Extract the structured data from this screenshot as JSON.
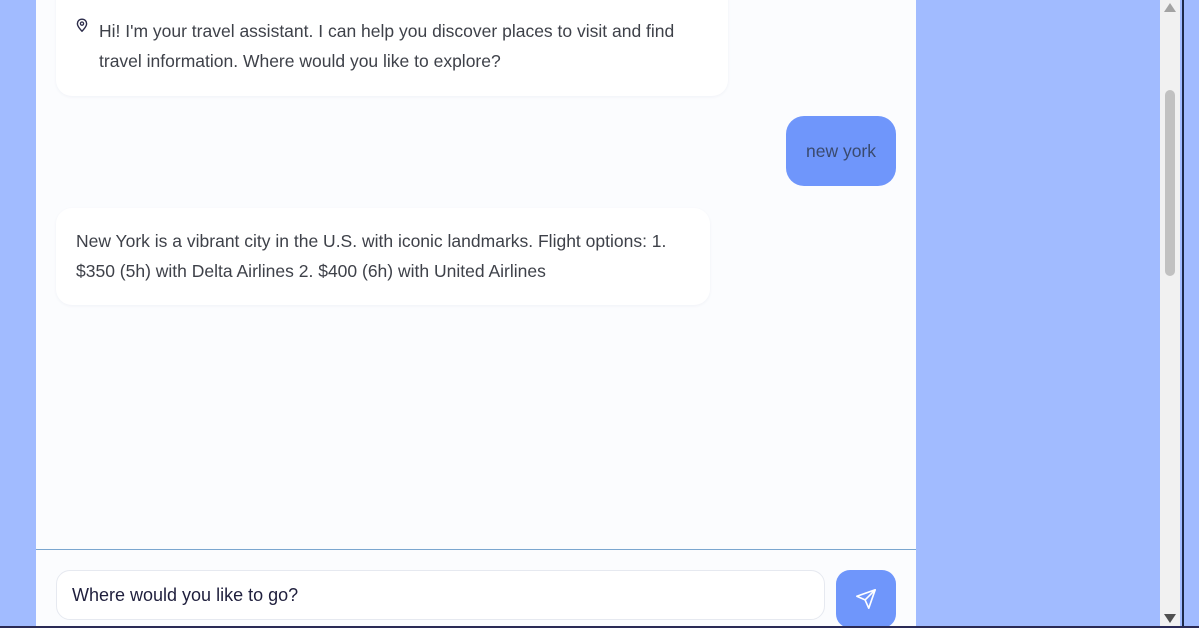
{
  "chat": {
    "messages": [
      {
        "role": "assistant",
        "icon": "map-pin-icon",
        "text": "Hi! I'm your travel assistant. I can help you discover places to visit and find travel information. Where would you like to explore?"
      },
      {
        "role": "user",
        "text": "new york"
      },
      {
        "role": "assistant",
        "text": "New York is a vibrant city in the U.S. with iconic landmarks. Flight options: 1. $350 (5h) with Delta Airlines 2. $400 (6h) with United Airlines"
      }
    ]
  },
  "composer": {
    "placeholder": "Where would you like to go?",
    "value": "",
    "send_icon": "send-icon"
  },
  "colors": {
    "page_background": "#a1bbff",
    "panel_background": "#fbfcfe",
    "accent": "#6f96fb",
    "text": "#3e4149"
  }
}
